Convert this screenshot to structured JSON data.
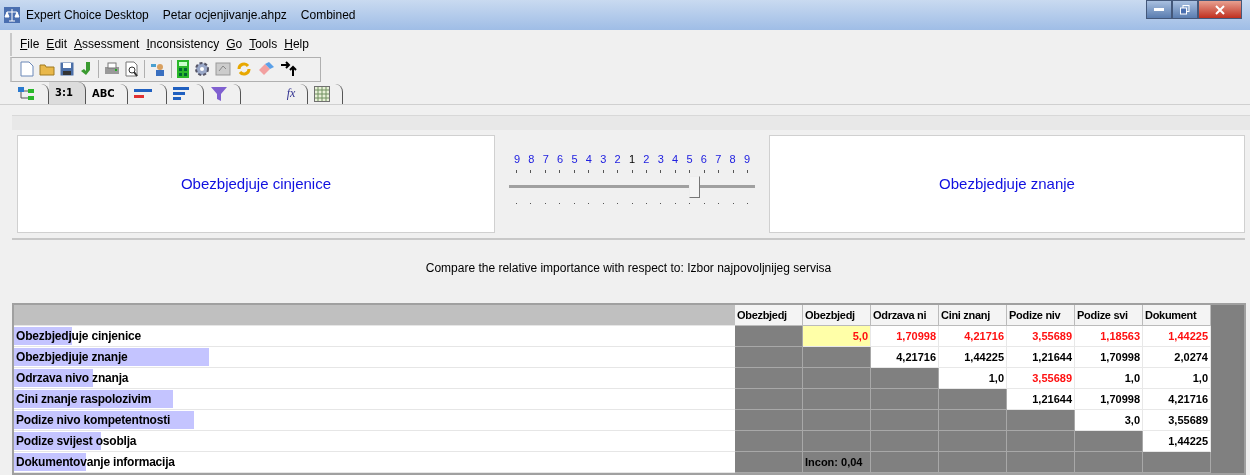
{
  "window": {
    "title": "Expert Choice Desktop",
    "file": "Petar ocjenjivanje.ahpz",
    "mode": "Combined"
  },
  "menu": [
    "File",
    "Edit",
    "Assessment",
    "Inconsistency",
    "Go",
    "Tools",
    "Help"
  ],
  "tabs": [
    {
      "selected": false
    },
    {
      "label": "3:1",
      "selected": true
    },
    {
      "label": "ABC",
      "selected": false
    },
    {
      "selected": false
    },
    {
      "selected": false
    },
    {
      "selected": false
    },
    {
      "label": "fx",
      "selected": false
    },
    {
      "selected": false
    }
  ],
  "comparison": {
    "left": "Obezbjedjuje cinjenice",
    "right": "Obezbjedjuje znanje",
    "scale": [
      "9",
      "8",
      "7",
      "6",
      "5",
      "4",
      "3",
      "2",
      "1",
      "2",
      "3",
      "4",
      "5",
      "6",
      "7",
      "8",
      "9"
    ],
    "level": 0.75
  },
  "prompt": "Compare the relative importance with respect to: Izbor najpovoljnijeg servisa",
  "table": {
    "columns": [
      "Obezbjedj",
      "Obezbjedj",
      "Odrzava ni",
      "Cini znanj",
      "Podize niv",
      "Podize svi",
      "Dokument"
    ],
    "rows": [
      {
        "label": "Obezbjedjuje cinjenice",
        "level": 0.08,
        "cells": [
          {
            "kind": "blank",
            "selected": false
          },
          {
            "kind": "value",
            "text": "5,0",
            "inverted": true,
            "selected": true
          },
          {
            "kind": "value",
            "text": "1,70998",
            "inverted": true,
            "selected": false
          },
          {
            "kind": "value",
            "text": "4,21716",
            "inverted": true,
            "selected": false
          },
          {
            "kind": "value",
            "text": "3,55689",
            "inverted": true,
            "selected": false
          },
          {
            "kind": "value",
            "text": "1,18563",
            "inverted": true,
            "selected": false
          },
          {
            "kind": "value",
            "text": "1,44225",
            "inverted": true,
            "selected": false
          }
        ]
      },
      {
        "label": "Obezbjedjuje znanje",
        "level": 0.27,
        "cells": [
          {
            "kind": "blank",
            "selected": false
          },
          {
            "kind": "blank",
            "selected": false
          },
          {
            "kind": "value",
            "text": "4,21716",
            "inverted": false,
            "selected": false
          },
          {
            "kind": "value",
            "text": "1,44225",
            "inverted": false,
            "selected": false
          },
          {
            "kind": "value",
            "text": "1,21644",
            "inverted": false,
            "selected": false
          },
          {
            "kind": "value",
            "text": "1,70998",
            "inverted": false,
            "selected": false
          },
          {
            "kind": "value",
            "text": "2,0274",
            "inverted": false,
            "selected": false
          }
        ]
      },
      {
        "label": "Odrzava nivo znanja",
        "level": 0.11,
        "cells": [
          {
            "kind": "blank",
            "selected": false
          },
          {
            "kind": "blank",
            "selected": false
          },
          {
            "kind": "blank",
            "selected": false
          },
          {
            "kind": "value",
            "text": "1,0",
            "inverted": false,
            "selected": false
          },
          {
            "kind": "value",
            "text": "3,55689",
            "inverted": true,
            "selected": false
          },
          {
            "kind": "value",
            "text": "1,0",
            "inverted": false,
            "selected": false
          },
          {
            "kind": "value",
            "text": "1,0",
            "inverted": false,
            "selected": false
          }
        ]
      },
      {
        "label": "Cini znanje raspolozivim",
        "level": 0.22,
        "cells": [
          {
            "kind": "blank",
            "selected": false
          },
          {
            "kind": "blank",
            "selected": false
          },
          {
            "kind": "blank",
            "selected": false
          },
          {
            "kind": "blank",
            "selected": false
          },
          {
            "kind": "value",
            "text": "1,21644",
            "inverted": false,
            "selected": false
          },
          {
            "kind": "value",
            "text": "1,70998",
            "inverted": false,
            "selected": false
          },
          {
            "kind": "value",
            "text": "4,21716",
            "inverted": false,
            "selected": false
          }
        ]
      },
      {
        "label": "Podize nivo kompetentnosti",
        "level": 0.25,
        "cells": [
          {
            "kind": "blank",
            "selected": false
          },
          {
            "kind": "blank",
            "selected": false
          },
          {
            "kind": "blank",
            "selected": false
          },
          {
            "kind": "blank",
            "selected": false
          },
          {
            "kind": "blank",
            "selected": false
          },
          {
            "kind": "value",
            "text": "3,0",
            "inverted": false,
            "selected": false
          },
          {
            "kind": "value",
            "text": "3,55689",
            "inverted": false,
            "selected": false
          }
        ]
      },
      {
        "label": "Podize svijest osoblja",
        "level": 0.12,
        "cells": [
          {
            "kind": "blank",
            "selected": false
          },
          {
            "kind": "blank",
            "selected": false
          },
          {
            "kind": "blank",
            "selected": false
          },
          {
            "kind": "blank",
            "selected": false
          },
          {
            "kind": "blank",
            "selected": false
          },
          {
            "kind": "blank",
            "selected": false
          },
          {
            "kind": "value",
            "text": "1,44225",
            "inverted": false,
            "selected": false
          }
        ]
      },
      {
        "label": "Dokumentovanje informacija",
        "level": 0.1,
        "cells": [
          {
            "kind": "blank",
            "selected": false
          },
          {
            "kind": "note",
            "text": "Incon: 0,04",
            "selected": false
          },
          {
            "kind": "blank",
            "selected": false
          },
          {
            "kind": "blank",
            "selected": false
          },
          {
            "kind": "blank",
            "selected": false
          },
          {
            "kind": "blank",
            "selected": false
          },
          {
            "kind": "blank",
            "selected": false
          }
        ]
      }
    ]
  }
}
